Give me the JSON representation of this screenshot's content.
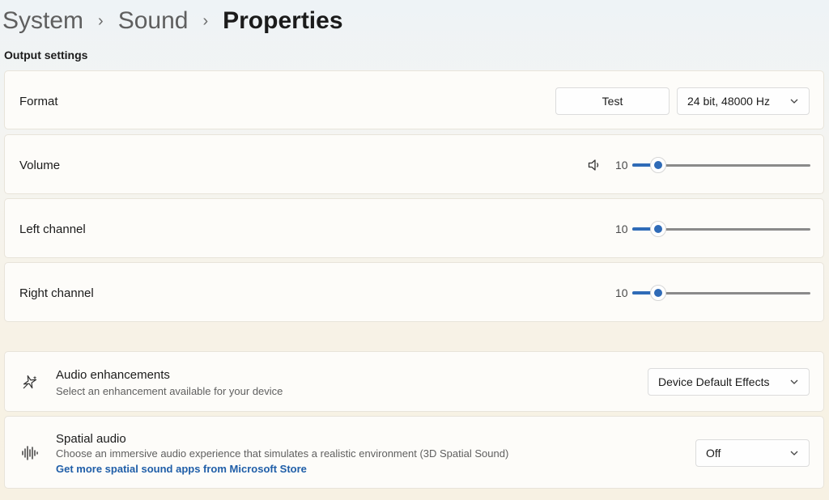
{
  "breadcrumb": {
    "items": [
      "System",
      "Sound",
      "Properties"
    ],
    "separator": "›"
  },
  "output_settings": {
    "title": "Output settings",
    "format": {
      "label": "Format",
      "test_button": "Test",
      "selected": "24 bit, 48000 Hz"
    },
    "volume": {
      "label": "Volume",
      "value": "10",
      "level": 0.1,
      "icon": "speaker-icon"
    },
    "left_channel": {
      "label": "Left channel",
      "value": "10",
      "level": 0.1
    },
    "right_channel": {
      "label": "Right channel",
      "value": "10",
      "level": 0.1
    }
  },
  "audio_enhancements": {
    "icon": "sparkle-icon",
    "title": "Audio enhancements",
    "description": "Select an enhancement available for your device",
    "selected": "Device Default Effects"
  },
  "spatial_audio": {
    "icon": "sound-wave-icon",
    "title": "Spatial audio",
    "description": "Choose an immersive audio experience that simulates a realistic environment (3D Spatial Sound)",
    "link": "Get more spatial sound apps from Microsoft Store",
    "selected": "Off"
  },
  "colors": {
    "accent": "#2f6bb7",
    "link": "#1f5ea8"
  }
}
